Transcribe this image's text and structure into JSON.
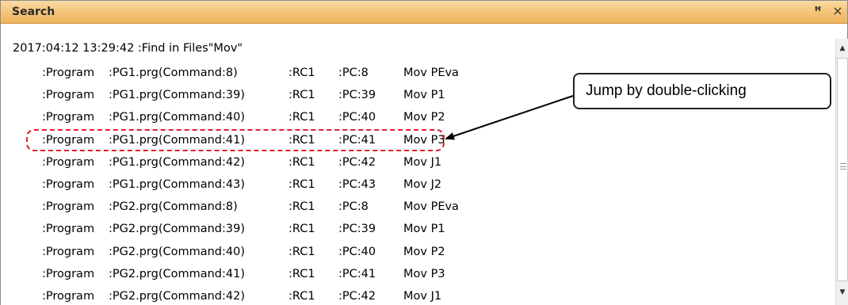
{
  "window": {
    "title": "Search",
    "pin_icon": "pin-icon",
    "close_icon": "close-icon",
    "pin_glyph": "ꟸ",
    "close_glyph": "×"
  },
  "log": {
    "header": "2017:04:12 13:29:42 :Find in Files\"Mov\"",
    "rows": [
      {
        "type": ":Program",
        "file": ":PG1.prg(Command:8)",
        "rc": ":RC1",
        "pc": ":PC:8",
        "cmd": "Mov PEva"
      },
      {
        "type": ":Program",
        "file": ":PG1.prg(Command:39)",
        "rc": ":RC1",
        "pc": ":PC:39",
        "cmd": "Mov P1"
      },
      {
        "type": ":Program",
        "file": ":PG1.prg(Command:40)",
        "rc": ":RC1",
        "pc": ":PC:40",
        "cmd": "Mov P2"
      },
      {
        "type": ":Program",
        "file": ":PG1.prg(Command:41)",
        "rc": ":RC1",
        "pc": ":PC:41",
        "cmd": "Mov P3"
      },
      {
        "type": ":Program",
        "file": ":PG1.prg(Command:42)",
        "rc": ":RC1",
        "pc": ":PC:42",
        "cmd": "Mov J1"
      },
      {
        "type": ":Program",
        "file": ":PG1.prg(Command:43)",
        "rc": ":RC1",
        "pc": ":PC:43",
        "cmd": "Mov J2"
      },
      {
        "type": ":Program",
        "file": ":PG2.prg(Command:8)",
        "rc": ":RC1",
        "pc": ":PC:8",
        "cmd": "Mov PEva"
      },
      {
        "type": ":Program",
        "file": ":PG2.prg(Command:39)",
        "rc": ":RC1",
        "pc": ":PC:39",
        "cmd": "Mov P1"
      },
      {
        "type": ":Program",
        "file": ":PG2.prg(Command:40)",
        "rc": ":RC1",
        "pc": ":PC:40",
        "cmd": "Mov P2"
      },
      {
        "type": ":Program",
        "file": ":PG2.prg(Command:41)",
        "rc": ":RC1",
        "pc": ":PC:41",
        "cmd": "Mov P3"
      },
      {
        "type": ":Program",
        "file": ":PG2.prg(Command:42)",
        "rc": ":RC1",
        "pc": ":PC:42",
        "cmd": "Mov J1"
      }
    ]
  },
  "callout": {
    "text": "Jump by double-clicking"
  },
  "colors": {
    "title_bar": "#f4c77c",
    "highlight_border": "#e0202a"
  }
}
